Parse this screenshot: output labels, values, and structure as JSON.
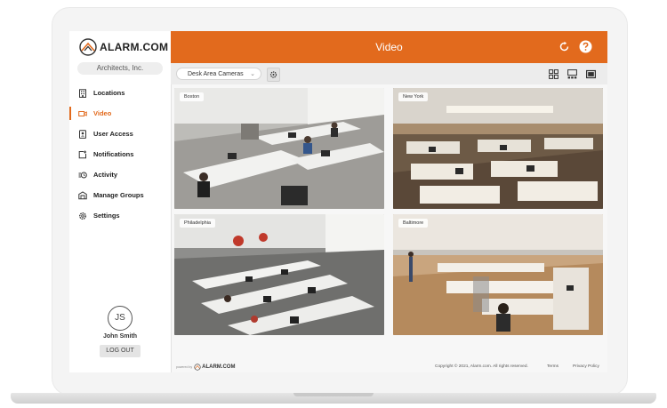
{
  "brand": {
    "name": "ALARM.COM"
  },
  "sidebar": {
    "organization": "Architects, Inc.",
    "items": [
      {
        "label": "Locations",
        "icon": "building-icon"
      },
      {
        "label": "Video",
        "icon": "video-camera-icon"
      },
      {
        "label": "User Access",
        "icon": "badge-icon"
      },
      {
        "label": "Notifications",
        "icon": "notification-icon"
      },
      {
        "label": "Activity",
        "icon": "activity-icon"
      },
      {
        "label": "Manage Groups",
        "icon": "folders-icon"
      },
      {
        "label": "Settings",
        "icon": "gear-icon"
      }
    ],
    "active_item": "Video"
  },
  "user": {
    "initials": "JS",
    "name": "John Smith",
    "logout_label": "LOG OUT"
  },
  "header": {
    "title": "Video"
  },
  "toolbar": {
    "camera_group": "Desk Area Cameras"
  },
  "cameras": [
    {
      "label": "Boston"
    },
    {
      "label": "New York"
    },
    {
      "label": "Philadelphia"
    },
    {
      "label": "Baltimore"
    }
  ],
  "footer": {
    "powered_by": "powered by",
    "brand": "ALARM.COM",
    "copyright": "Copyright © 2021, Alarm.com. All rights reserved.",
    "terms": "Terms",
    "privacy": "Privacy Policy"
  },
  "colors": {
    "accent": "#e26a1d",
    "header_text": "#ffffff"
  }
}
